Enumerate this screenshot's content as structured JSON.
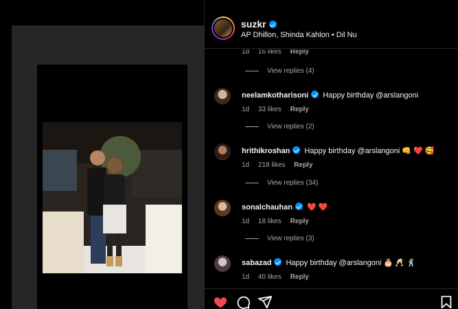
{
  "post": {
    "username": "suzkr",
    "audio": "AP Dhillon, Shinda Kahlon • Dil Nu"
  },
  "top_meta": {
    "time": "1d",
    "likes": "16 likes",
    "reply": "Reply"
  },
  "replies_1": "View replies (4)",
  "comments": [
    {
      "username": "neelamkotharisoni",
      "text": "Happy birthday @arslangoni",
      "time": "1d",
      "likes": "33 likes",
      "reply": "Reply",
      "view_replies": "View replies (2)"
    },
    {
      "username": "hrithikroshan",
      "text": "Happy birthday @arslangoni 👊 ❤️ 🥰",
      "time": "1d",
      "likes": "218 likes",
      "reply": "Reply",
      "view_replies": "View replies (34)"
    },
    {
      "username": "sonalchauhan",
      "text": "❤️ ❤️",
      "time": "1d",
      "likes": "18 likes",
      "reply": "Reply",
      "view_replies": "View replies (3)"
    },
    {
      "username": "sabazad",
      "text": "Happy birthday @arslangoni 🎂 🥂 🕺",
      "time": "1d",
      "likes": "40 likes",
      "reply": "Reply"
    }
  ],
  "actions": {
    "like": "heart-filled-icon",
    "comment": "comment-icon",
    "share": "share-icon",
    "save": "bookmark-icon",
    "like_color": "#ed4956"
  }
}
